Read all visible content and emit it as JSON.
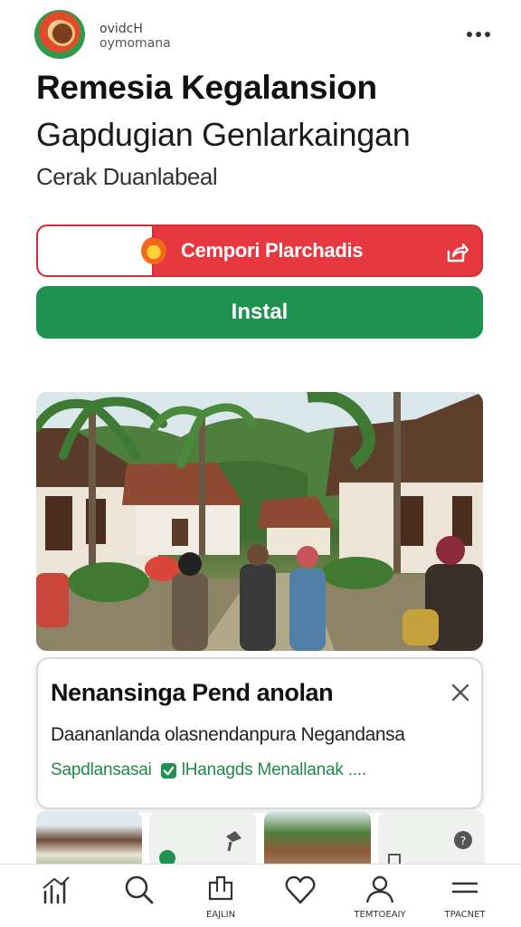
{
  "header": {
    "logo_icon": "app-logo-icon",
    "developer_line1": "ovidcH",
    "developer_line2": "oymomana",
    "more_icon": "more-dots-icon"
  },
  "app": {
    "title": "Remesia Kegalansion",
    "subtitle": "Gapdugian Genlarkaingan",
    "category": "Cerak Duanlabeal"
  },
  "buttons": {
    "primary_red_label": "Cempori Plarchadis",
    "primary_red_icon": "flame-icon",
    "share_icon": "share-icon",
    "install_label": "Instal",
    "red_color": "#e8383f",
    "green_color": "#1f9150"
  },
  "notification": {
    "title": "Nenansinga Pend anolan",
    "description": "Daananlanda olasnendanpura Negandansa",
    "link1": "Sapdlansasai",
    "link2": "lHanagds Menallanak ....",
    "close_icon": "close-icon",
    "check_icon": "check-badge-icon"
  },
  "bottom_nav": {
    "items": [
      {
        "label": "",
        "icon": "chart-icon"
      },
      {
        "label": "",
        "icon": "search-icon"
      },
      {
        "label": "EAJLIN",
        "icon": "apps-icon"
      },
      {
        "label": "",
        "icon": "heart-icon"
      },
      {
        "label": "TEMTOEAIY",
        "icon": "profile-icon"
      },
      {
        "label": "TPACNET",
        "icon": "menu-icon"
      }
    ]
  }
}
